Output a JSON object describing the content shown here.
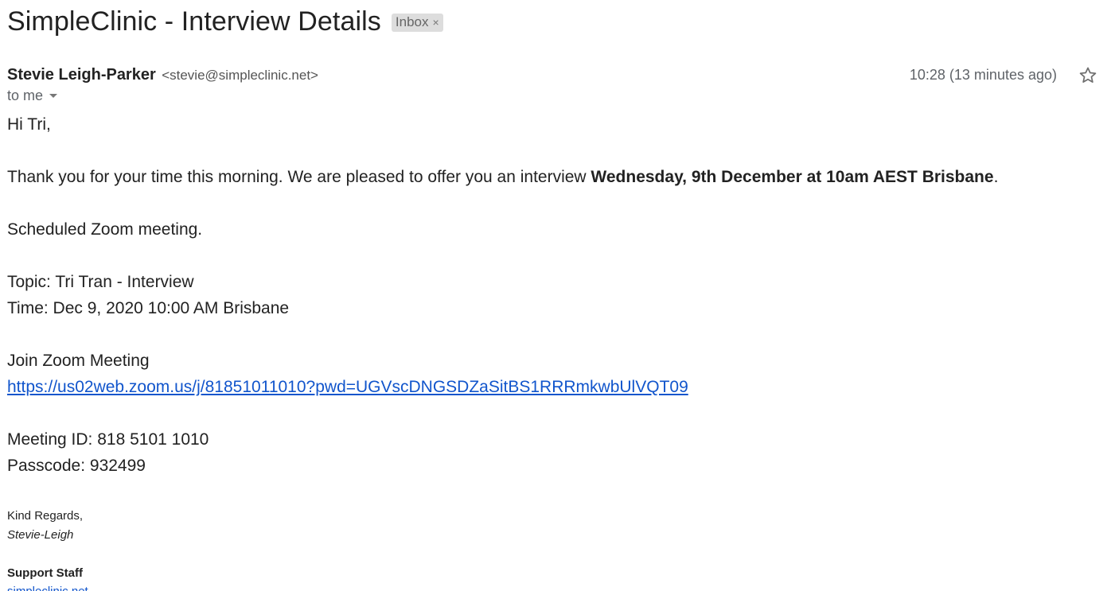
{
  "email": {
    "subject": "SimpleClinic - Interview Details",
    "label": "Inbox",
    "label_remove": "×",
    "sender_name": "Stevie Leigh-Parker",
    "sender_email": "<stevie@simpleclinic.net>",
    "timestamp": "10:28 (13 minutes ago)",
    "to_line": "to me",
    "icons": {
      "star": "star-icon",
      "caret": "chevron-down-icon"
    },
    "colors": {
      "link": "#1155cc",
      "label_bg": "#dddddd",
      "meta": "#5f6368"
    }
  },
  "body": {
    "greeting": "Hi Tri,",
    "thanks_prefix": "Thank you for your time this morning. We are pleased to offer you an interview ",
    "thanks_bold": "Wednesday, 9th December at 10am AEST Brisbane",
    "thanks_suffix": ".",
    "scheduled": "Scheduled Zoom meeting.",
    "topic": "Topic: Tri Tran - Interview",
    "time": "Time: Dec 9, 2020 10:00 AM Brisbane",
    "join": "Join Zoom Meeting",
    "zoom_link": "https://us02web.zoom.us/j/81851011010?pwd=UGVscDNGSDZaSitBS1RRRmkwbUlVQT09",
    "meeting_id": "Meeting ID: 818 5101 1010",
    "passcode": "Passcode: 932499"
  },
  "signature": {
    "regards": "Kind Regards,",
    "name": "Stevie-Leigh",
    "role": "Support Staff",
    "website": "simpleclinic.net"
  }
}
